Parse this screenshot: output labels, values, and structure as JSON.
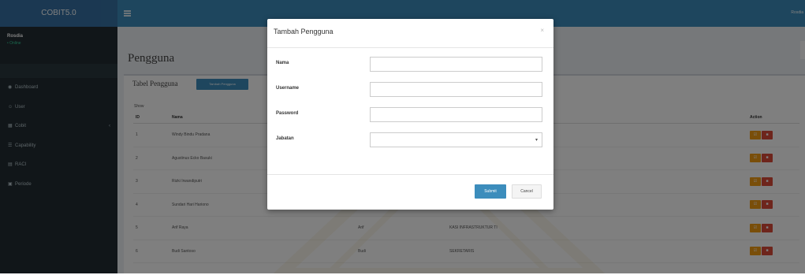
{
  "brand": "COBIT5.0",
  "topbar": {
    "user": "Rosdia"
  },
  "sidebar": {
    "user_name": "Rosdia",
    "user_status": "• Online",
    "items": [
      {
        "label": "Dashboard",
        "icon": "dashboard-icon",
        "glyph": "◉"
      },
      {
        "label": "User",
        "icon": "user-icon",
        "glyph": "☺"
      },
      {
        "label": "Cobit",
        "icon": "grid-icon",
        "glyph": "▦",
        "arrow": "‹"
      },
      {
        "label": "Capability",
        "icon": "list-icon",
        "glyph": "☰"
      },
      {
        "label": "RACI",
        "icon": "table-icon",
        "glyph": "▤"
      },
      {
        "label": "Periode",
        "icon": "calendar-icon",
        "glyph": "▣"
      }
    ]
  },
  "page": {
    "title": "Pengguna"
  },
  "table_box": {
    "title": "Tabel Pengguna",
    "add_button": "Tambah Pengguna",
    "entries_label": "Show",
    "columns": [
      "ID",
      "Nama",
      "",
      "",
      "Action"
    ],
    "rows": [
      {
        "id": "1",
        "nama": "Windy Bindu Pradana",
        "username": "",
        "jabatan": ""
      },
      {
        "id": "2",
        "nama": "Agustinus Ecko Basuki",
        "username": "",
        "jabatan": ""
      },
      {
        "id": "3",
        "nama": "Rizki Irwandiputri",
        "username": "",
        "jabatan": ""
      },
      {
        "id": "4",
        "nama": "Sundari Hari Hariono",
        "username": "",
        "jabatan": ""
      },
      {
        "id": "5",
        "nama": "Arif Raya",
        "username": "Arif",
        "jabatan": "KASI INFRASTRUKTUR TI"
      },
      {
        "id": "6",
        "nama": "Budi Santoso",
        "username": "Budi",
        "jabatan": "SEKRETARIS"
      }
    ],
    "edit_glyph": "☑",
    "delete_glyph": "■"
  },
  "modal": {
    "title": "Tambah Pengguna",
    "close": "×",
    "fields": [
      {
        "label": "Nama",
        "value": "",
        "type": "text"
      },
      {
        "label": "Username",
        "value": "",
        "type": "text"
      },
      {
        "label": "Password",
        "value": "",
        "type": "password"
      },
      {
        "label": "Jabatan",
        "value": "",
        "type": "select"
      }
    ],
    "select_arrow": "▾",
    "submit": "Submit",
    "cancel": "Cancel"
  },
  "colors": {
    "primary": "#3c8dbc",
    "sidebar": "#222d32",
    "edit": "#f39c12",
    "delete": "#dd4b39"
  }
}
